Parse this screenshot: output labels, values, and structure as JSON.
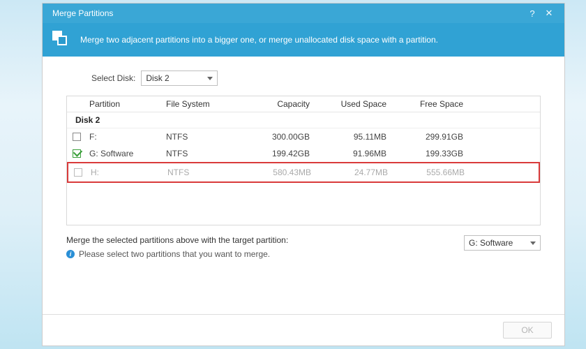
{
  "title": "Merge Partitions",
  "banner_text": "Merge two adjacent partitions into a bigger one, or merge unallocated disk space with a partition.",
  "select_disk_label": "Select Disk:",
  "select_disk_value": "Disk 2",
  "columns": {
    "c0": "",
    "c1": "Partition",
    "c2": "File System",
    "c3": "Capacity",
    "c4": "Used Space",
    "c5": "Free Space"
  },
  "group_header": "Disk 2",
  "rows": [
    {
      "checked": false,
      "partition": "F:",
      "fs": "NTFS",
      "capacity": "300.00GB",
      "used": "95.11MB",
      "free": "299.91GB",
      "dim": false
    },
    {
      "checked": true,
      "partition": "G: Software",
      "fs": "NTFS",
      "capacity": "199.42GB",
      "used": "91.96MB",
      "free": "199.33GB",
      "dim": false
    },
    {
      "checked": false,
      "partition": "H:",
      "fs": "NTFS",
      "capacity": "580.43MB",
      "used": "24.77MB",
      "free": "555.66MB",
      "dim": true
    }
  ],
  "merge_label": "Merge the selected partitions above with the target partition:",
  "info_text": "Please select two partitions that you want to merge.",
  "target_value": "G: Software",
  "ok_label": "OK"
}
